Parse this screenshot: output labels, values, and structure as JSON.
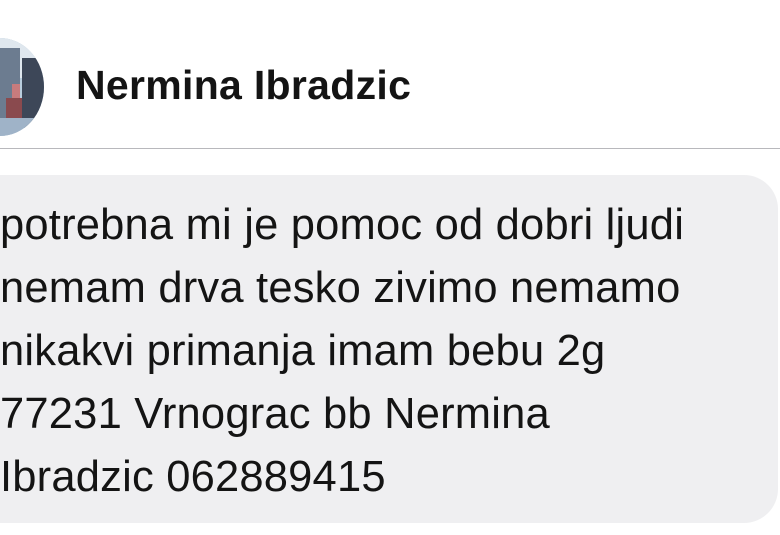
{
  "conversation": {
    "sender_name": "Nermina Ibradzic",
    "avatar_icon": "profile-photo-avatar-icon"
  },
  "message": {
    "lines": [
      "potrebna mi je pomoc od dobri ljudi",
      "nemam drva tesko zivimo nemamo",
      "nikakvi primanja imam bebu 2g",
      "77231 Vrnograc bb Nermina",
      "Ibradzic 062889415"
    ],
    "bubble_color": "#efeff1",
    "text_color": "#141414"
  }
}
